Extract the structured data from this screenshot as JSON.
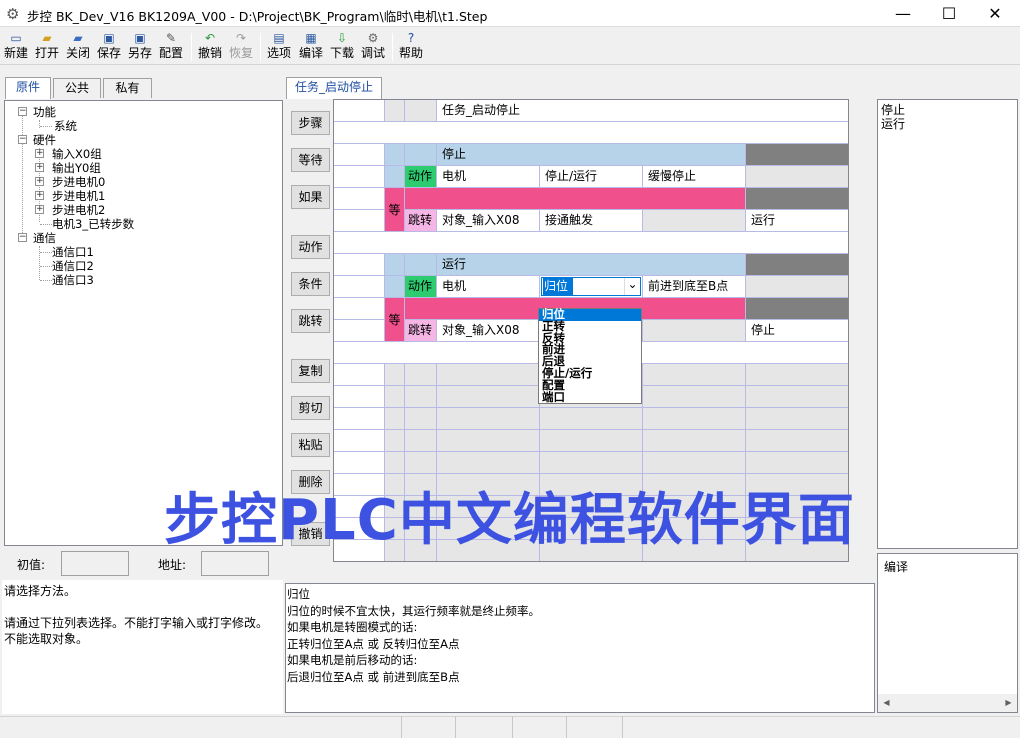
{
  "window": {
    "title": "步控  BK_Dev_V16    BK1209A_V00   -  D:\\Project\\BK_Program\\临时\\电机\\t1.Step",
    "minimize": "—",
    "maximize": "☐",
    "close": "✕"
  },
  "toolbar": [
    {
      "label": "新建",
      "icon": "new-file-icon",
      "glyph": "▭"
    },
    {
      "label": "打开",
      "icon": "open-folder-icon",
      "glyph": "▰"
    },
    {
      "label": "关闭",
      "icon": "close-file-icon",
      "glyph": "▰"
    },
    {
      "label": "保存",
      "icon": "save-icon",
      "glyph": "▣"
    },
    {
      "label": "另存",
      "icon": "save-as-icon",
      "glyph": "▣"
    },
    {
      "label": "配置",
      "icon": "wrench-icon",
      "glyph": "✎"
    },
    {
      "label": "撤销",
      "icon": "undo-icon",
      "glyph": "↶"
    },
    {
      "label": "恢复",
      "icon": "redo-icon",
      "glyph": "↷"
    },
    {
      "label": "选项",
      "icon": "options-icon",
      "glyph": "▤"
    },
    {
      "label": "编译",
      "icon": "compile-icon",
      "glyph": "▦"
    },
    {
      "label": "下载",
      "icon": "download-icon",
      "glyph": "⇩"
    },
    {
      "label": "调试",
      "icon": "debug-icon",
      "glyph": "⚙"
    },
    {
      "label": "帮助",
      "icon": "help-icon",
      "glyph": "?"
    }
  ],
  "left_tabs": [
    "原件",
    "公共",
    "私有"
  ],
  "tree": [
    {
      "label": "功能",
      "expander": "−"
    },
    {
      "label": "系统",
      "expander": ""
    },
    {
      "label": "硬件",
      "expander": "−"
    },
    {
      "label": "输入X0组",
      "expander": "+"
    },
    {
      "label": "输出Y0组",
      "expander": "+"
    },
    {
      "label": "步进电机0",
      "expander": "+"
    },
    {
      "label": "步进电机1",
      "expander": "+"
    },
    {
      "label": "步进电机2",
      "expander": "+"
    },
    {
      "label": "电机3_已转步数",
      "expander": ""
    },
    {
      "label": "通信",
      "expander": "−"
    },
    {
      "label": "通信口1",
      "expander": ""
    },
    {
      "label": "通信口2",
      "expander": ""
    },
    {
      "label": "通信口3",
      "expander": ""
    }
  ],
  "fields": {
    "init_label": "初值:",
    "addr_label": "地址:"
  },
  "help_left": {
    "line1": "请选择方法。",
    "line2": "请通过下拉列表选择。不能打字输入或打字修改。",
    "line3": "不能选取对象。"
  },
  "editor_tab": "任务_启动停止",
  "side_buttons": [
    "步骤",
    "等待",
    "如果",
    "动作",
    "条件",
    "跳转",
    "复制",
    "剪切",
    "粘贴",
    "删除",
    "撤销"
  ],
  "grid": {
    "task_name": "任务_启动停止",
    "step1": {
      "name": "停止",
      "action_tag": "动作",
      "object": "电机",
      "method": "停止/运行",
      "param": "缓慢停止",
      "wait_tag": "等",
      "jump_tag": "跳转",
      "cond_object": "对象_输入X08",
      "cond": "接通触发",
      "target": "运行"
    },
    "step2": {
      "name": "运行",
      "action_tag": "动作",
      "object": "电机",
      "method": "归位",
      "param": "前进到底至B点",
      "wait_tag": "等",
      "jump_tag": "跳转",
      "cond_object": "对象_输入X08",
      "target": "停止"
    }
  },
  "dropdown": {
    "arrow": "⌄",
    "options": [
      "归位",
      "正转",
      "反转",
      "前进",
      "后退",
      "停止/运行",
      "配置",
      "端口"
    ]
  },
  "right_top": {
    "line1": "停止",
    "line2": "运行"
  },
  "right_bottom": {
    "label": "编译"
  },
  "help_center": {
    "lines": [
      "归位",
      "归位的时候不宜太快，其运行频率就是终止频率。",
      "如果电机是转圈模式的话:",
      "正转归位至A点 或 反转归位至A点",
      "如果电机是前后移动的话:",
      "后退归位至A点 或 前进到底至B点"
    ]
  },
  "overlay_text": "步控PLC中文编程软件界面",
  "colors": {
    "row_header": "#b7d3ea",
    "dark": "#808080",
    "pink": "#f0508c",
    "green": "#2ecc71",
    "jump": "#f5b6e6",
    "light_gray": "#e6e6e6",
    "accent_tab": "#1f4fa3",
    "overlay": "#3d52e0"
  }
}
